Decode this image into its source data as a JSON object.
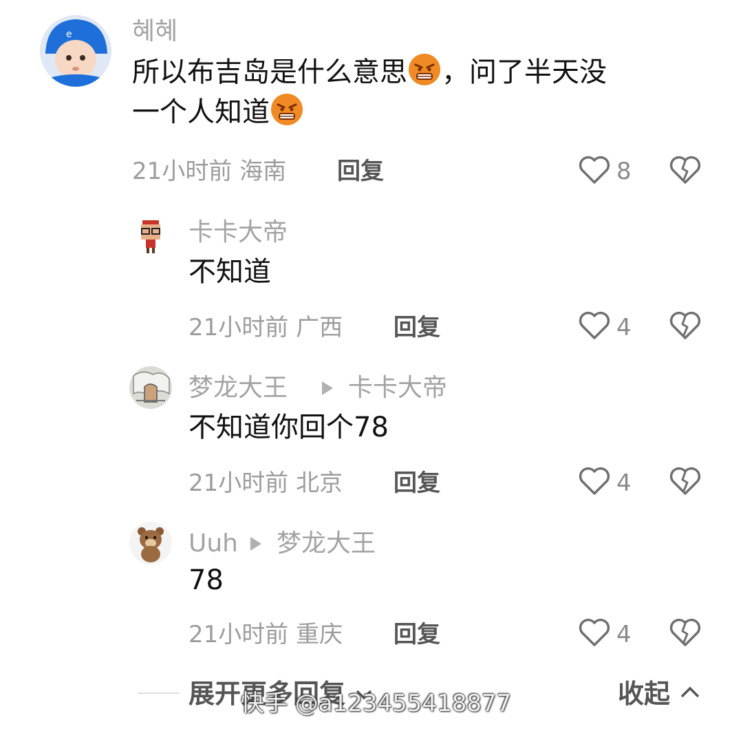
{
  "comments": [
    {
      "username": "혜혜",
      "text_part1": "所以布吉岛是什么意思",
      "text_part2": "，问了半天没",
      "text_part3": "一个人知道",
      "time": "21小时前",
      "location": "海南",
      "reply_label": "回复",
      "likes": "8"
    },
    {
      "username": "卡卡大帝",
      "text": "不知道",
      "time": "21小时前",
      "location": "广西",
      "reply_label": "回复",
      "likes": "4"
    },
    {
      "username": "梦龙大王",
      "reply_to": "卡卡大帝",
      "text": "不知道你回个78",
      "time": "21小时前",
      "location": "北京",
      "reply_label": "回复",
      "likes": "4"
    },
    {
      "username": "Uuh",
      "reply_to": "梦龙大王",
      "text": "78",
      "time": "21小时前",
      "location": "重庆",
      "reply_label": "回复",
      "likes": "4"
    }
  ],
  "footer": {
    "expand_label": "展开更多回复",
    "collapse_label": "收起"
  },
  "watermark": "快手 @a123455418877",
  "icons": {
    "like": "heart-outline-icon",
    "dislike": "broken-heart-icon",
    "reply_arrow": "play-triangle-icon",
    "emoji": "angry-face-emoji"
  },
  "colors": {
    "name": "#a3a3a3",
    "body": "#111111",
    "meta": "#9c9c9c",
    "emoji": "#f08a24"
  }
}
